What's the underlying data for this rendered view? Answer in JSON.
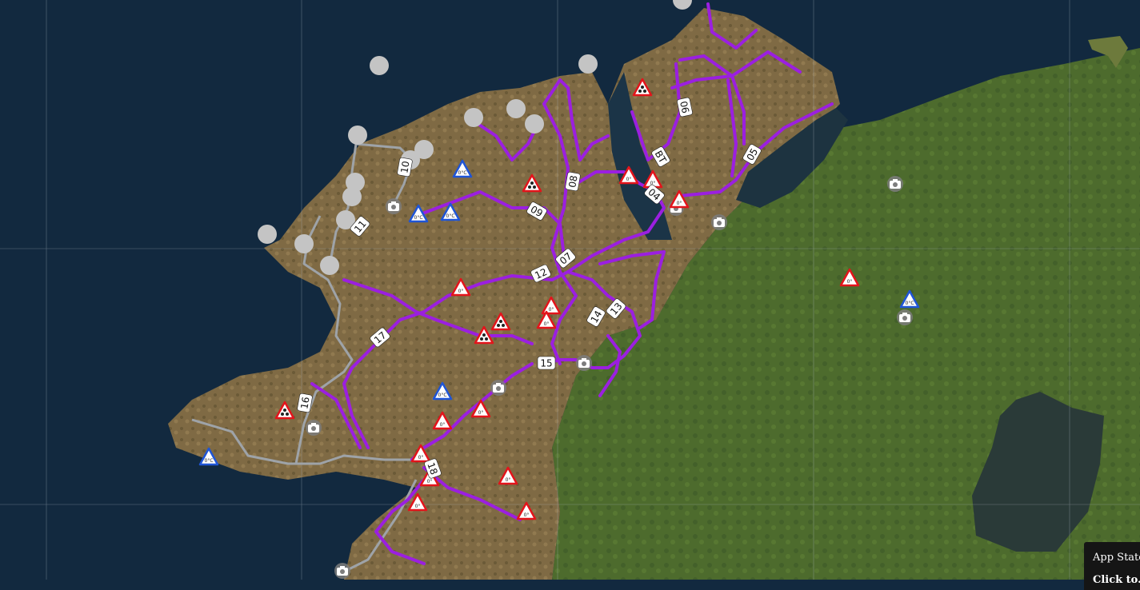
{
  "map": {
    "colors": {
      "sea": "#12293f",
      "land": "#6d6a3a",
      "bog": "#8a6f47",
      "green": "#4a6a2c",
      "road_purple": "#9b1fe0",
      "road_grey": "#9ea3a8",
      "marker_grey": "#c4c4c4",
      "warning_red": "#e3141b",
      "warning_blue": "#1f55d6",
      "grid": "#a9b4bd",
      "lough": "#2a3a3a"
    },
    "route_labels": [
      "06",
      "BT",
      "05",
      "04",
      "08",
      "09",
      "10",
      "11",
      "07",
      "12",
      "13",
      "14",
      "15",
      "17",
      "16",
      "18"
    ],
    "warning_icons": [
      {
        "type": "snow-warning-icon",
        "symbol": "snow",
        "color": "red"
      },
      {
        "type": "ice-warning-icon",
        "symbol": "0°C",
        "color": "red"
      },
      {
        "type": "freezing-temp-icon",
        "symbol": "0°C",
        "color": "blue"
      }
    ],
    "blue_temp_text": "0°C",
    "red_temp_text": "0°",
    "snow_glyph": "❄",
    "camera_icon": "camera-icon",
    "station_icon": "weather-station-marker"
  },
  "panel": {
    "title": "App State",
    "hint": "Click to..."
  }
}
